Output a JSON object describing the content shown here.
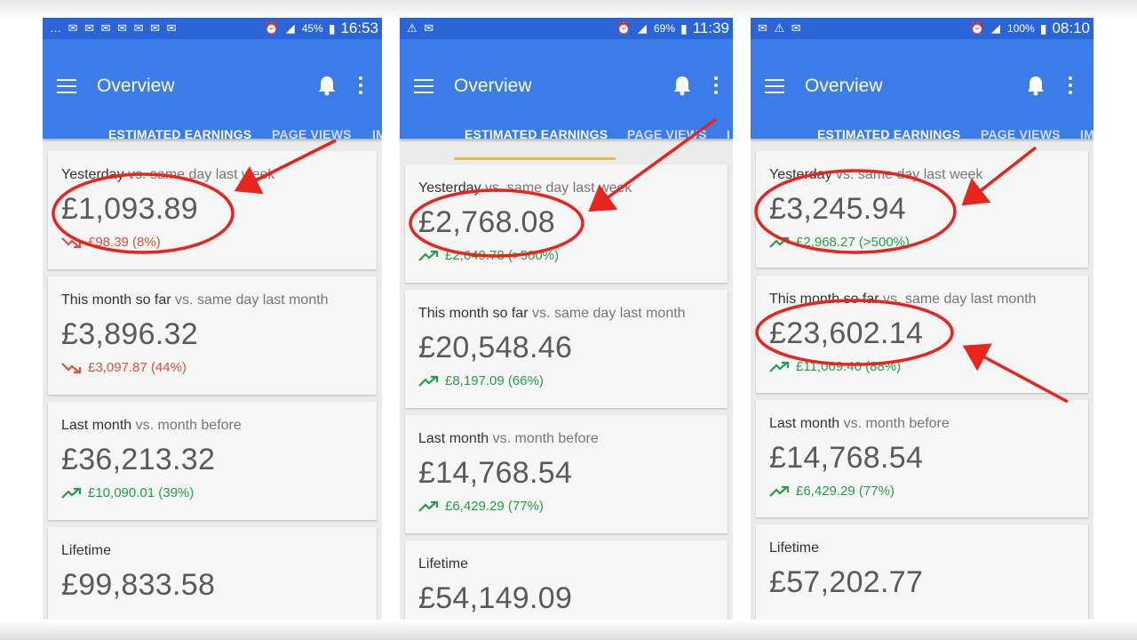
{
  "colors": {
    "appbar": "#3b7ce8",
    "statusbar": "#2a65d8",
    "tab_underline": "#e8b947",
    "trend_up": "#259c4a",
    "trend_down": "#d9513b",
    "annotation": "#e8241b"
  },
  "phones": [
    {
      "status": {
        "icons_left": "… ✉ ✉ ✉ ✉ ✉ ✉ ✉",
        "battery": "45%",
        "time": "16:53"
      },
      "header": {
        "title": "Overview"
      },
      "tabs": [
        {
          "label": "ESTIMATED EARNINGS",
          "active": true
        },
        {
          "label": "PAGE VIEWS",
          "active": false
        },
        {
          "label": "IM",
          "active": false
        }
      ],
      "cards": [
        {
          "label_strong": "Yesterday",
          "label_rest": " vs. same day last week",
          "value": "£1,093.89",
          "change": "£98.39 (8%)",
          "trend": "down"
        },
        {
          "label_strong": "This month so far",
          "label_rest": " vs. same day last month",
          "value": "£3,896.32",
          "change": "£3,097.87 (44%)",
          "trend": "down"
        },
        {
          "label_strong": "Last month",
          "label_rest": " vs. month before",
          "value": "£36,213.32",
          "change": "£10,090.01 (39%)",
          "trend": "up"
        },
        {
          "label_strong": "Lifetime",
          "label_rest": "",
          "value": "£99,833.58",
          "change": "",
          "trend": "none"
        }
      ]
    },
    {
      "status": {
        "icons_left": "⚠ ✉",
        "battery": "69%",
        "time": "11:39"
      },
      "header": {
        "title": "Overview"
      },
      "tabs": [
        {
          "label": "ESTIMATED EARNINGS",
          "active": true
        },
        {
          "label": "PAGE VIEWS",
          "active": false
        },
        {
          "label": "I",
          "active": false
        }
      ],
      "cards": [
        {
          "label_strong": "Yesterday",
          "label_rest": " vs. same day last week",
          "value": "£2,768.08",
          "change": "£2,649.78 (>500%)",
          "trend": "up"
        },
        {
          "label_strong": "This month so far",
          "label_rest": " vs. same day last month",
          "value": "£20,548.46",
          "change": "£8,197.09 (66%)",
          "trend": "up"
        },
        {
          "label_strong": "Last month",
          "label_rest": " vs. month before",
          "value": "£14,768.54",
          "change": "£6,429.29 (77%)",
          "trend": "up"
        },
        {
          "label_strong": "Lifetime",
          "label_rest": "",
          "value": "£54,149.09",
          "change": "",
          "trend": "none"
        }
      ]
    },
    {
      "status": {
        "icons_left": "✉ ⚠ ✉",
        "battery": "100%",
        "time": "08:10"
      },
      "header": {
        "title": "Overview"
      },
      "tabs": [
        {
          "label": "ESTIMATED EARNINGS",
          "active": true
        },
        {
          "label": "PAGE VIEWS",
          "active": false
        },
        {
          "label": "IM",
          "active": false
        }
      ],
      "cards": [
        {
          "label_strong": "Yesterday",
          "label_rest": " vs. same day last week",
          "value": "£3,245.94",
          "change": "£2,968.27 (>500%)",
          "trend": "up"
        },
        {
          "label_strong": "This month so far",
          "label_rest": " vs. same day last month",
          "value": "£23,602.14",
          "change": "£11,069.40 (88%)",
          "trend": "up"
        },
        {
          "label_strong": "Last month",
          "label_rest": " vs. month before",
          "value": "£14,768.54",
          "change": "£6,429.29 (77%)",
          "trend": "up"
        },
        {
          "label_strong": "Lifetime",
          "label_rest": "",
          "value": "£57,202.77",
          "change": "",
          "trend": "none"
        }
      ]
    }
  ]
}
